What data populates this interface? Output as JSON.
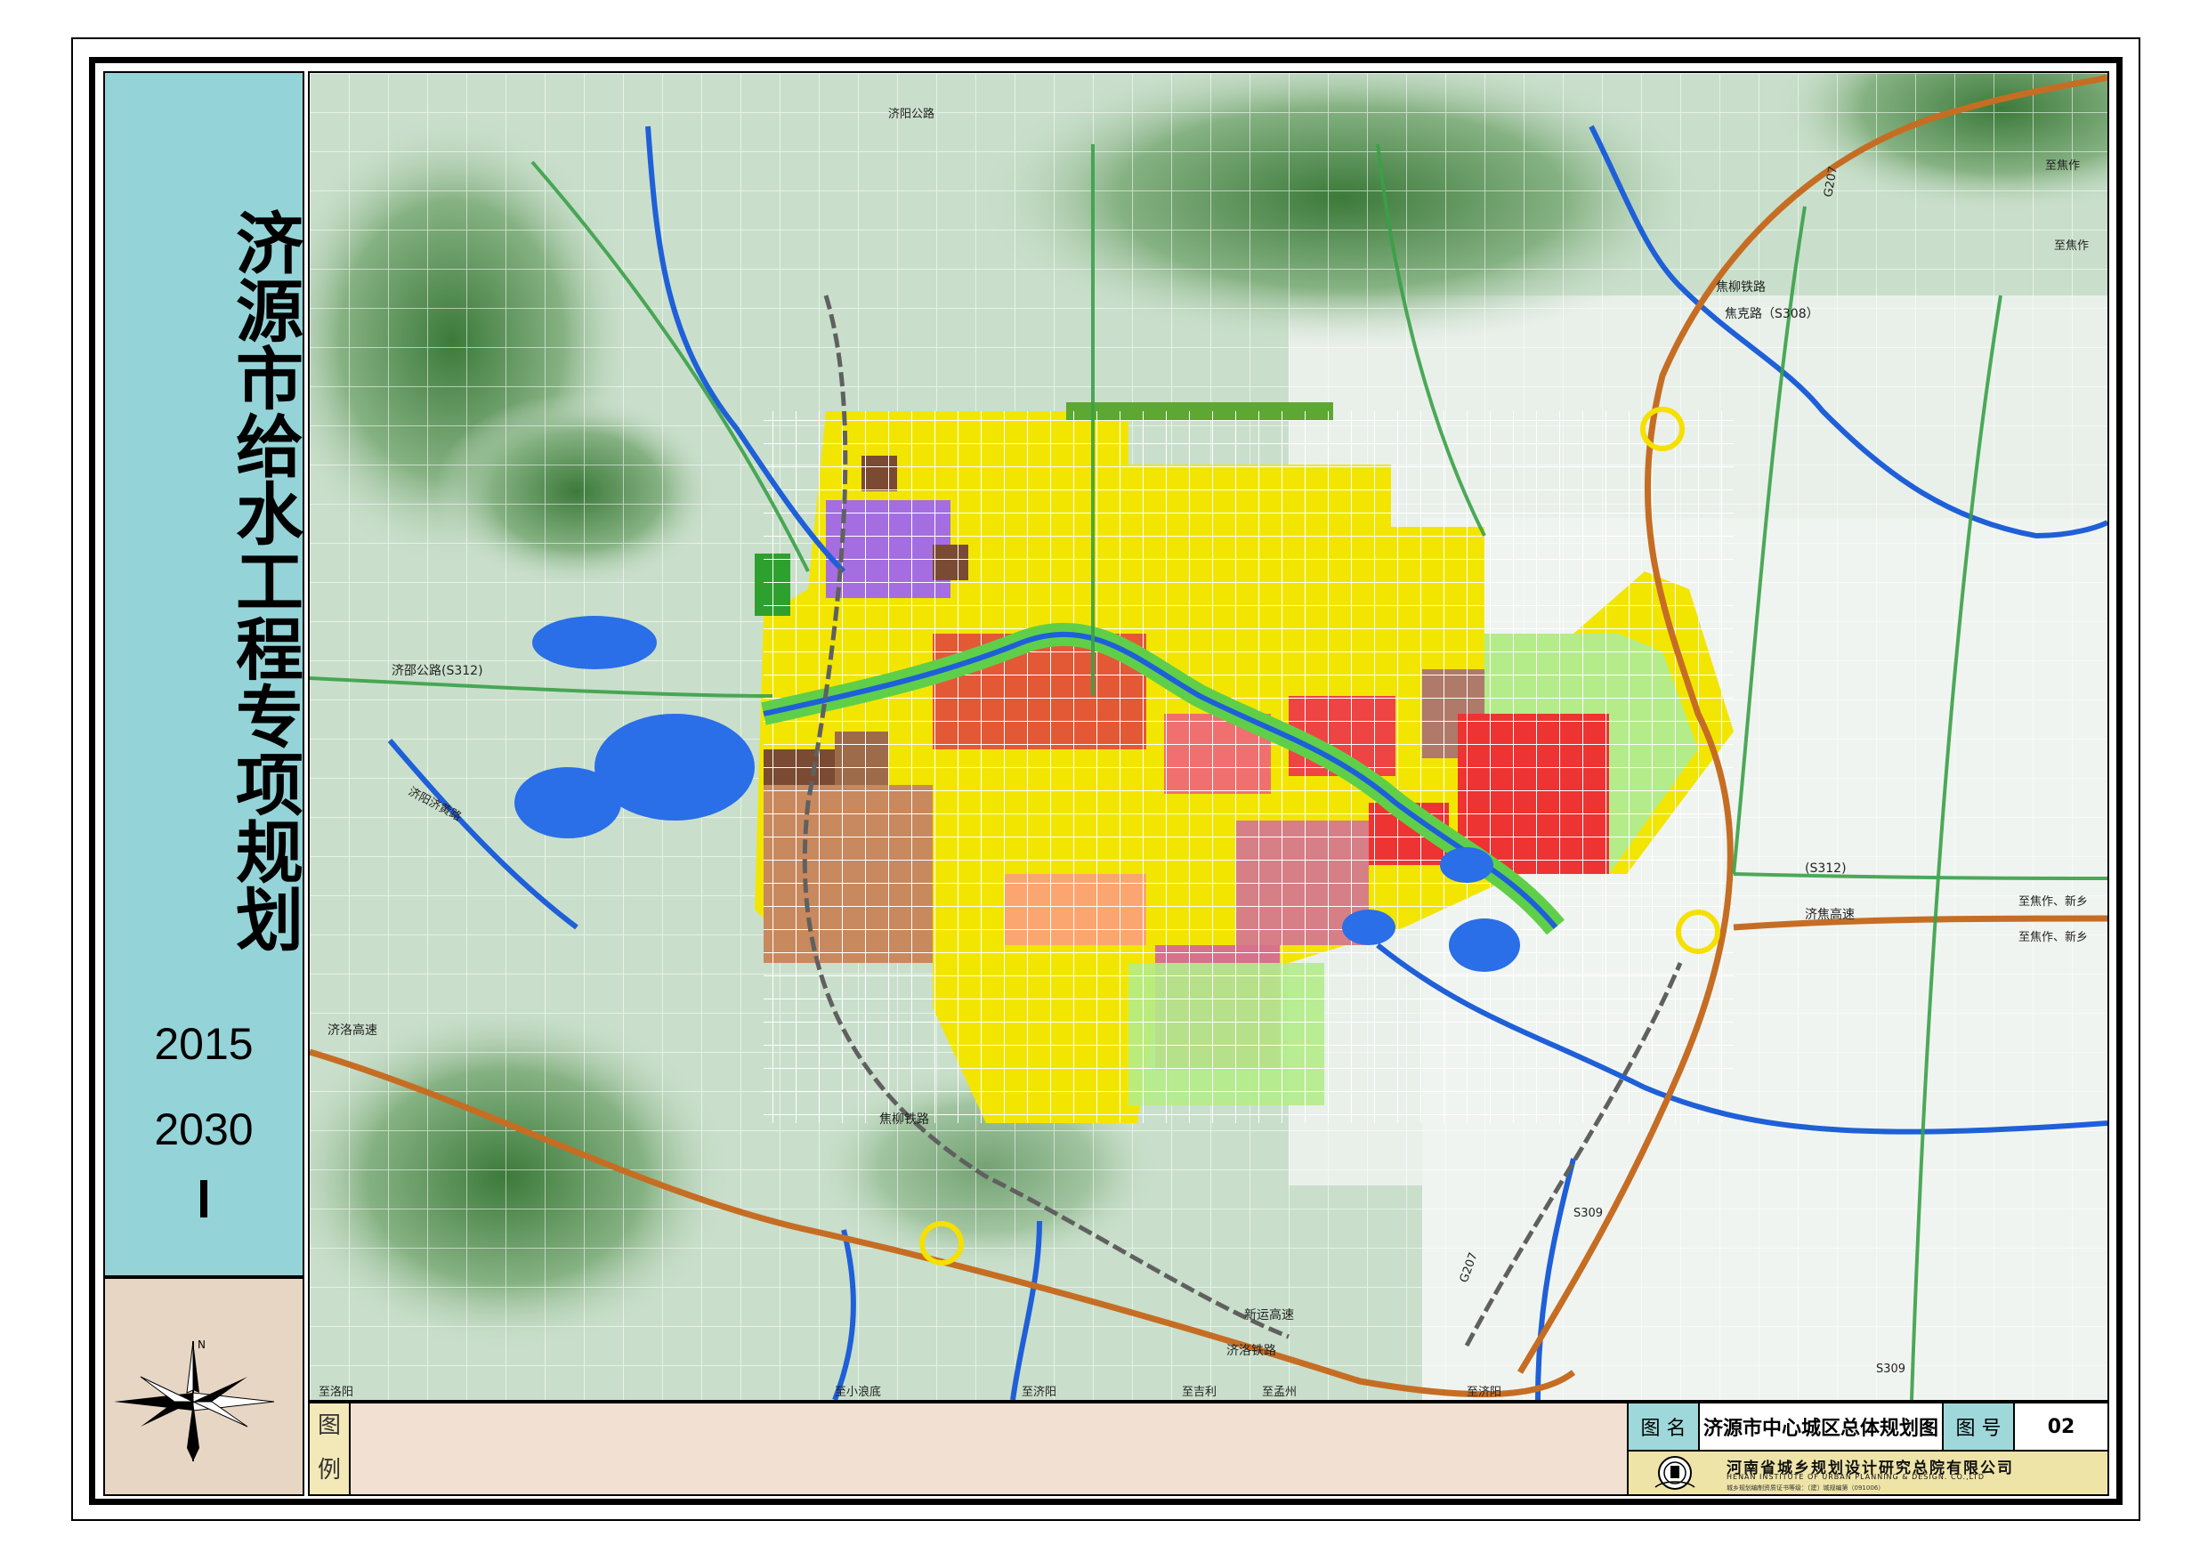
{
  "title_panel": {
    "title": "济源市给水工程专项规划",
    "year_start": "2015",
    "year_end": "2030"
  },
  "compass": {
    "north_label": "N"
  },
  "legend": {
    "label_1": "图",
    "label_2": "例"
  },
  "info": {
    "map_name_label": "图 名",
    "map_name": "济源市中心城区总体规划图",
    "map_no_label": "图 号",
    "map_no": "02",
    "company_cn": "河南省城乡规划设计研究总院有限公司",
    "company_en": "HENAN INSTITUTE OF URBAN PLANNING & DESIGN. CO.,LTD",
    "company_note": "城乡规划编制资质证书等级：〔建〕城规编第（091006）"
  },
  "map_labels": {
    "road_jiyuan_s312": "济邵公路(S312)",
    "road_s312_east": "(S312)",
    "to_jiaozuo_xinxiang_1": "至焦作、新乡",
    "to_jiaozuo_xinxiang_2": "至焦作、新乡",
    "expressway_east": "济焦高速",
    "expressway_west": "济洛高速",
    "railway_jiaoliu_n": "焦柳铁路",
    "railway_jiaoliu_s": "焦柳铁路",
    "road_s308": "焦克路（S308）",
    "road_s309": "S309",
    "road_s309_2": "S309",
    "road_g207": "G207",
    "road_g207_s": "G207",
    "to_jiaozuo_ne": "至焦作",
    "to_jiaozuo_ne2": "至焦作",
    "xinyuan_expressway": "新运高速",
    "jiluo_railway": "济洛铁路",
    "to_luoyang_w": "至洛阳",
    "to_xiaolangdi": "至小浪底",
    "to_jiyang": "至济阳",
    "to_jiyuan_s": "至济阳",
    "to_jixin": "至吉利",
    "to_mengzhou": "至孟州",
    "yellow_river_road": "济阳济黄路",
    "road_north": "济阳公路"
  }
}
